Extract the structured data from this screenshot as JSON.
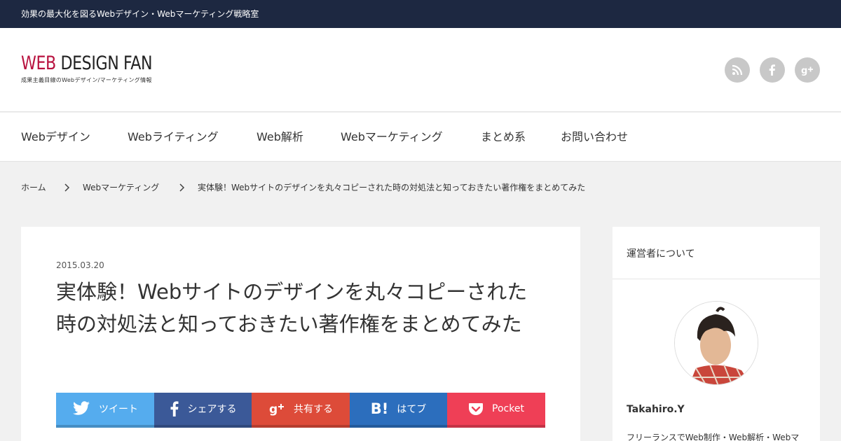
{
  "topbar": {
    "tagline": "効果の最大化を図るWebデザイン・Webマーケティング戦略室"
  },
  "logo": {
    "web": "WEB",
    "rest": " DESIGN FAN",
    "subtitle": "成果主義目線のWebデザイン/マーケティング情報"
  },
  "social_icons": [
    "rss-icon",
    "facebook-icon",
    "google-plus-icon"
  ],
  "nav": {
    "items": [
      {
        "label": "Webデザイン"
      },
      {
        "label": "Webライティング"
      },
      {
        "label": "Web解析"
      },
      {
        "label": "Webマーケティング"
      },
      {
        "label": "まとめ系"
      },
      {
        "label": "お問い合わせ"
      }
    ]
  },
  "breadcrumb": {
    "home": "ホーム",
    "category": "Webマーケティング",
    "current": "実体験！Webサイトのデザインを丸々コピーされた時の対処法と知っておきたい著作権をまとめてみた"
  },
  "article": {
    "date": "2015.03.20",
    "title": "実体験！Webサイトのデザインを丸々コピーされた時の対処法と知っておきたい著作権をまとめてみた"
  },
  "share": {
    "twitter": "ツイート",
    "facebook": "シェアする",
    "gplus": "共有する",
    "hatena_icon": "B!",
    "hatena": "はてブ",
    "pocket": "Pocket"
  },
  "colors": {
    "topbar": "#1d2841",
    "logo_accent": "#b8123f",
    "twitter": "#55acee",
    "facebook": "#3b5998",
    "gplus": "#dd4b39",
    "hatena": "#2c6ebd",
    "pocket": "#ef3f56"
  },
  "sidebar": {
    "title": "運営者について",
    "author_name": "Takahiro.Y",
    "author_bio": "フリーランスでWeb制作・Web解析・Webマ"
  }
}
